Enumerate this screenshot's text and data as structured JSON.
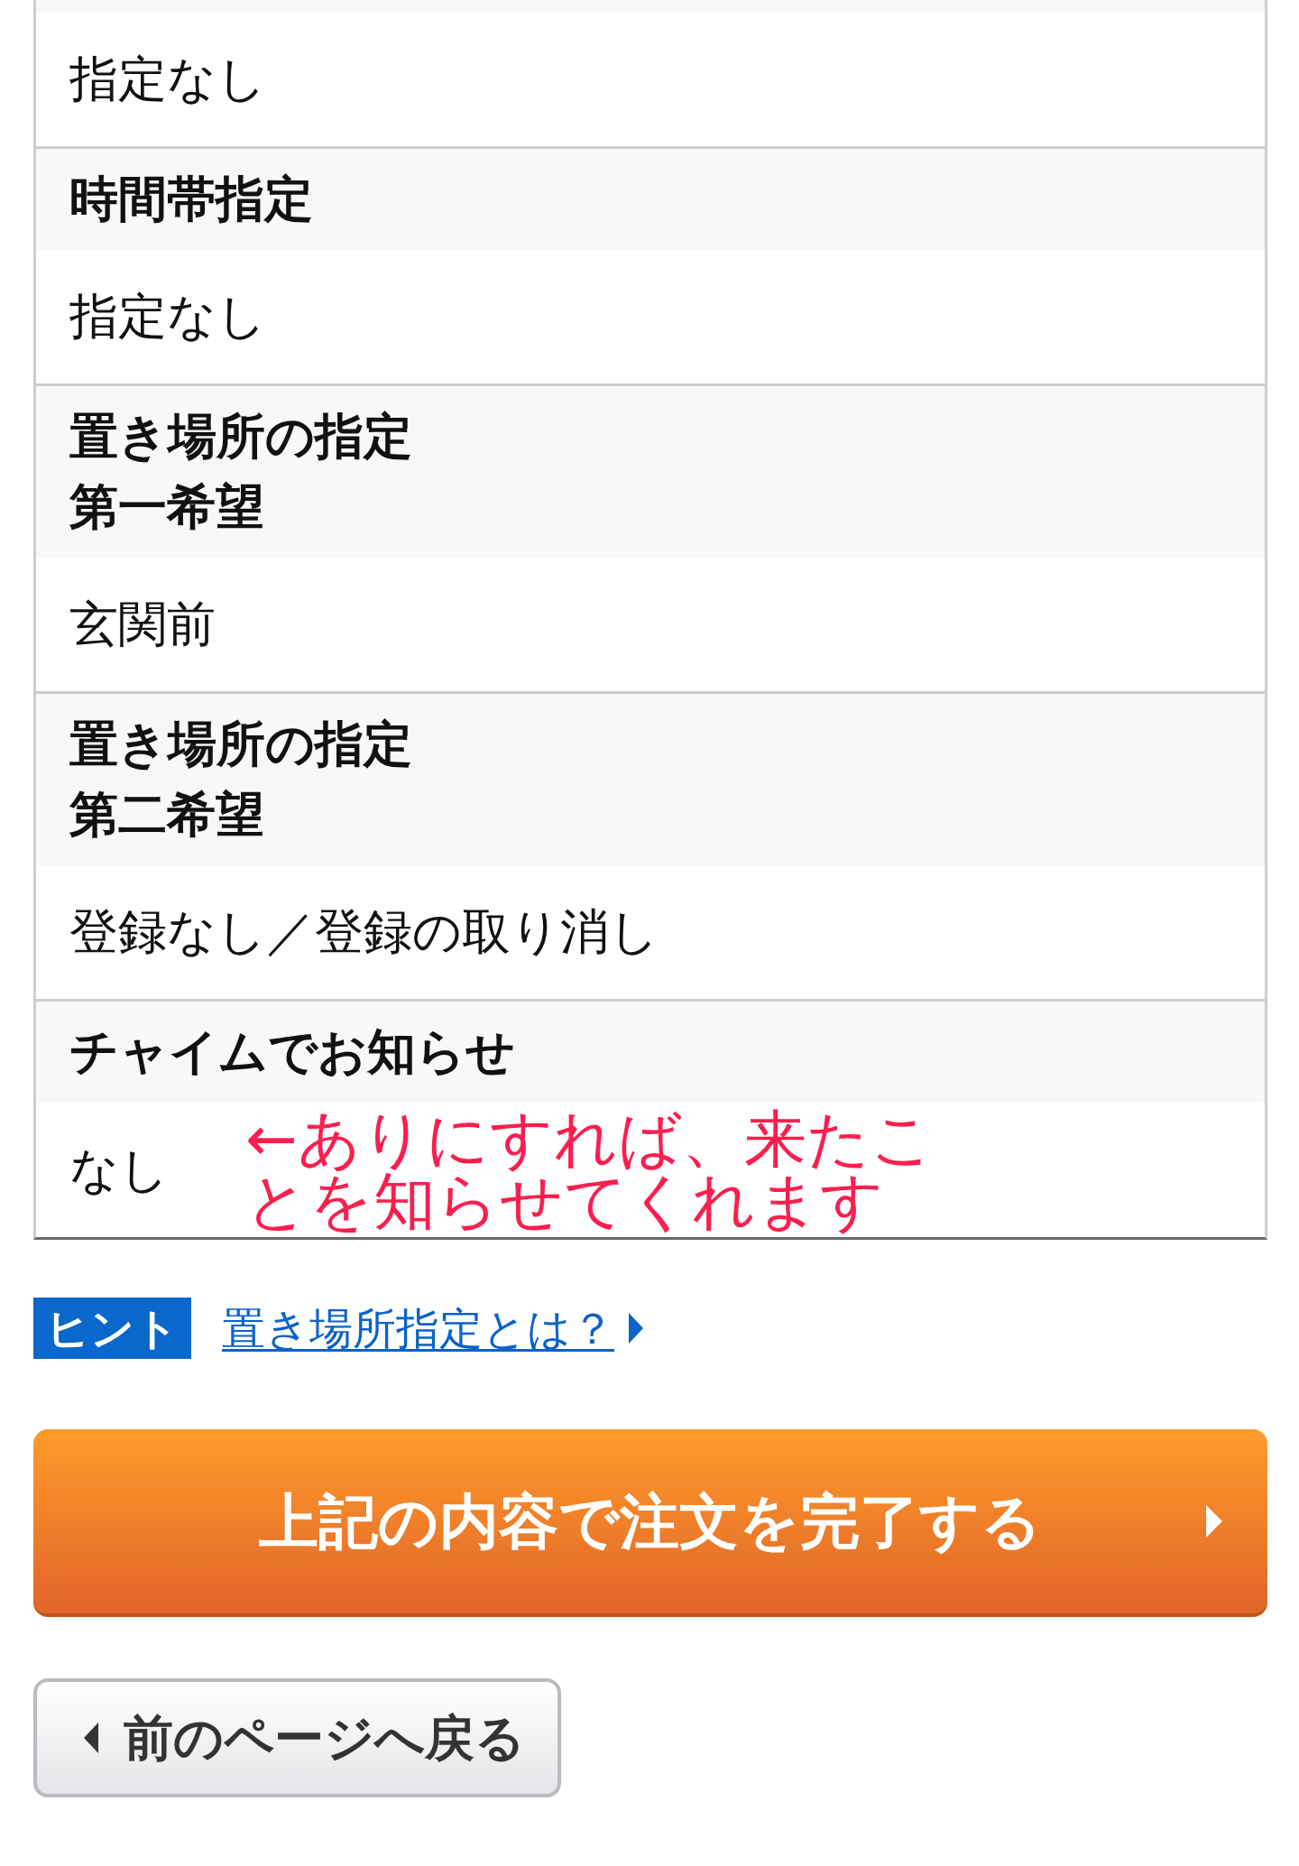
{
  "table": {
    "rows": [
      {
        "kind": "value",
        "text": "指定なし"
      },
      {
        "kind": "header",
        "lines": [
          "時間帯指定"
        ]
      },
      {
        "kind": "value",
        "text": "指定なし"
      },
      {
        "kind": "header",
        "lines": [
          "置き場所の指定",
          "第一希望"
        ]
      },
      {
        "kind": "value",
        "text": "玄関前"
      },
      {
        "kind": "header",
        "lines": [
          "置き場所の指定",
          "第二希望"
        ]
      },
      {
        "kind": "value",
        "text": "登録なし／登録の取り消し"
      },
      {
        "kind": "header",
        "lines": [
          "チャイムでお知らせ"
        ]
      },
      {
        "kind": "value",
        "text": "なし",
        "annotation": "←ありにすれば、来たことを知らせてくれます"
      }
    ]
  },
  "hint": {
    "badge": "ヒント",
    "link": "置き場所指定とは？"
  },
  "buttons": [
    {
      "kind": "primary",
      "label": "上記の内容で注文を完了する"
    },
    {
      "kind": "back",
      "label": "前のページへ戻る"
    }
  ]
}
